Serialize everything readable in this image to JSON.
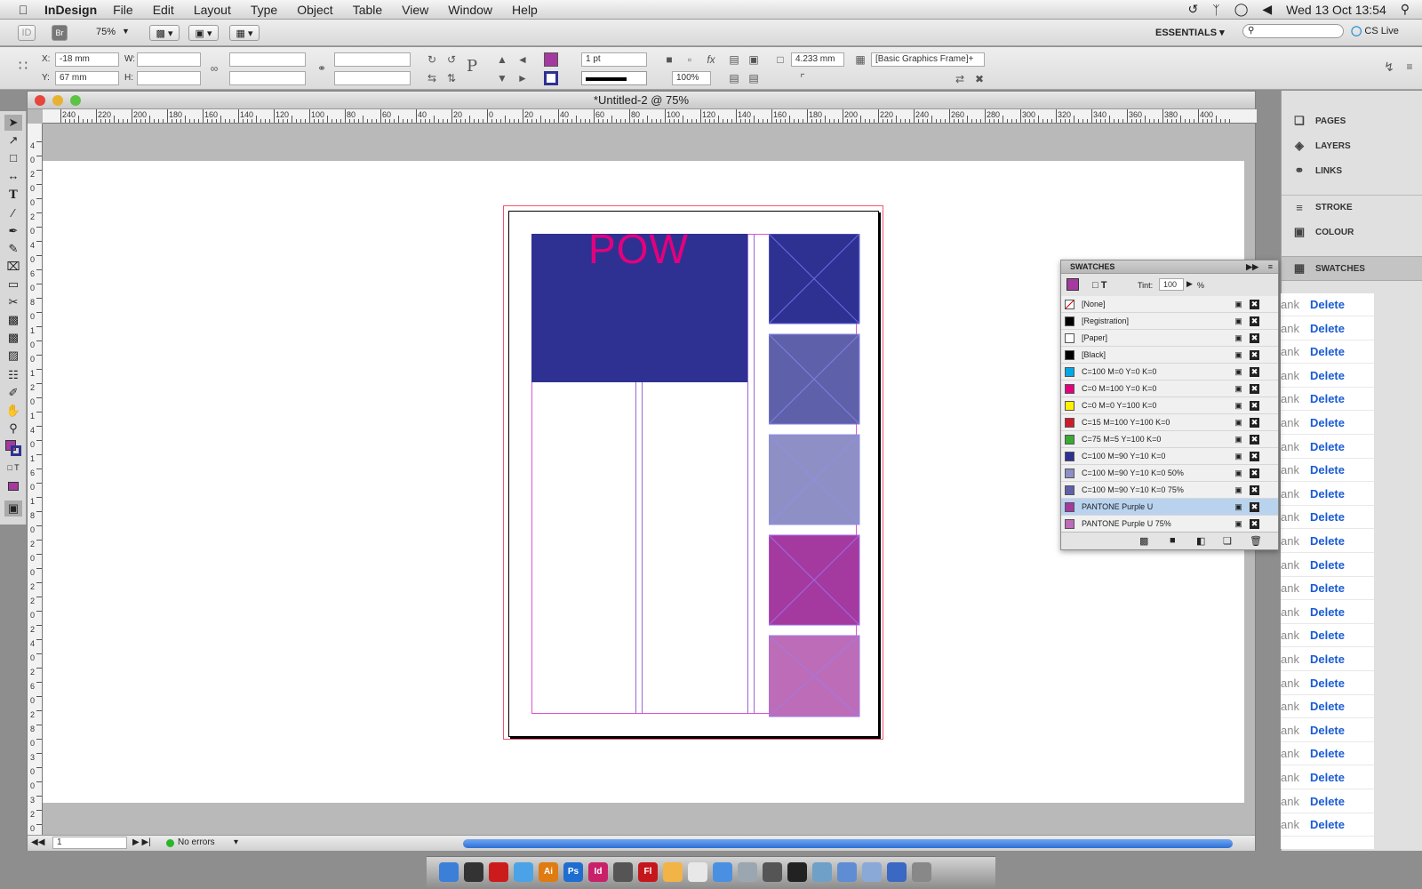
{
  "menubar": {
    "app_name": "InDesign",
    "items": [
      "File",
      "Edit",
      "Layout",
      "Type",
      "Object",
      "Table",
      "View",
      "Window",
      "Help"
    ],
    "clock": "Wed 13 Oct  13:54"
  },
  "appbar": {
    "zoom": "75%",
    "workspace": "ESSENTIALS",
    "cs_live": "CS Live"
  },
  "control": {
    "x_label": "X:",
    "x_value": "-18 mm",
    "y_label": "Y:",
    "y_value": "67 mm",
    "w_label": "W:",
    "h_label": "H:",
    "stroke_weight": "1 pt",
    "opacity": "100%",
    "gap": "4.233 mm",
    "object_style": "[Basic Graphics Frame]+"
  },
  "document": {
    "title": "*Untitled-2 @ 75%",
    "headline": "POW",
    "page_number": "1",
    "preflight": "No errors",
    "ruler_ticks": [
      "240",
      "220",
      "200",
      "180",
      "160",
      "140",
      "120",
      "100",
      "80",
      "60",
      "40",
      "20",
      "0",
      "20",
      "40",
      "60",
      "80",
      "100",
      "120",
      "140",
      "160",
      "180",
      "200",
      "220",
      "240",
      "260",
      "280",
      "300",
      "320",
      "340",
      "360",
      "380",
      "400"
    ],
    "vruler_ticks": [
      "4",
      "0",
      "2",
      "0",
      "0",
      "2",
      "0",
      "4",
      "0",
      "6",
      "0",
      "8",
      "0",
      "1",
      "0",
      "0",
      "1",
      "2",
      "0",
      "1",
      "4",
      "0",
      "1",
      "6",
      "0",
      "1",
      "8",
      "0",
      "2",
      "0",
      "0",
      "2",
      "2",
      "0",
      "2",
      "4",
      "0",
      "2",
      "6",
      "0",
      "2",
      "8",
      "0",
      "3",
      "0",
      "0",
      "3",
      "2",
      "0"
    ]
  },
  "dock": {
    "pages": "PAGES",
    "layers": "LAYERS",
    "links": "LINKS",
    "stroke": "STROKE",
    "colour": "COLOUR",
    "swatches": "SWATCHES"
  },
  "delete_list": {
    "blank_label": "ank",
    "delete_label": "Delete",
    "rows": 23
  },
  "swatches_panel": {
    "title": "SWATCHES",
    "tint_label": "Tint:",
    "tint_value": "100",
    "tint_unit": "%",
    "swatches": [
      {
        "name": "[None]",
        "color": "#ffffff",
        "selected": false
      },
      {
        "name": "[Registration]",
        "color": "#000000",
        "selected": false
      },
      {
        "name": "[Paper]",
        "color": "#ffffff",
        "selected": false
      },
      {
        "name": "[Black]",
        "color": "#000000",
        "selected": false
      },
      {
        "name": "C=100 M=0 Y=0 K=0",
        "color": "#00a9e6",
        "selected": false
      },
      {
        "name": "C=0 M=100 Y=0 K=0",
        "color": "#e4007d",
        "selected": false
      },
      {
        "name": "C=0 M=0 Y=100 K=0",
        "color": "#fff100",
        "selected": false
      },
      {
        "name": "C=15 M=100 Y=100 K=0",
        "color": "#d1192e",
        "selected": false
      },
      {
        "name": "C=75 M=5 Y=100 K=0",
        "color": "#3aaa35",
        "selected": false
      },
      {
        "name": "C=100 M=90 Y=10 K=0",
        "color": "#2e3192",
        "selected": false
      },
      {
        "name": "C=100 M=90 Y=10 K=0 50%",
        "color": "#8e8fc5",
        "selected": false
      },
      {
        "name": "C=100 M=90 Y=10 K=0 75%",
        "color": "#5f60aa",
        "selected": false
      },
      {
        "name": "PANTONE Purple U",
        "color": "#a43a9f",
        "selected": true
      },
      {
        "name": "PANTONE Purple U 75%",
        "color": "#bd6cb8",
        "selected": false
      }
    ]
  },
  "colors": {
    "deep_blue": "#2e3192",
    "purple": "#a43a9f",
    "magenta": "#e4007d",
    "bleed_red": "#f0576f",
    "margin_pink": "#e052d3",
    "link_blue": "#1a5bd6"
  },
  "macdock_apps": [
    "Finder",
    "Dashboard",
    "Opera",
    "Safari",
    "Ai",
    "Ps",
    "Id",
    "Help",
    "Fl",
    "Pages",
    "iCal",
    "Fetch",
    "Preview",
    "Chess",
    "Terminal",
    "iPhoto",
    "Apps",
    "Docs",
    "Downloads",
    "Trash"
  ]
}
